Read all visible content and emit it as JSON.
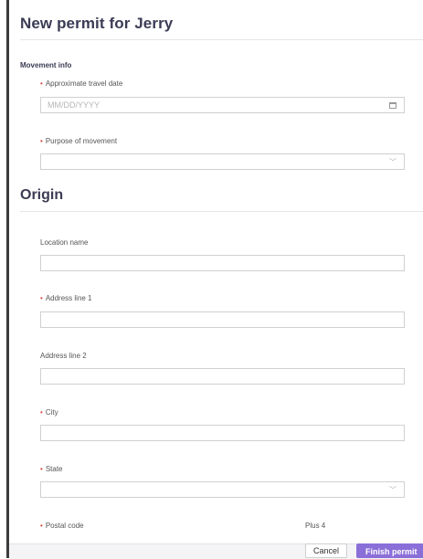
{
  "header": {
    "title": "New permit for Jerry"
  },
  "movement_info": {
    "section_label": "Movement info",
    "travel_date": {
      "label": "Approximate travel date",
      "placeholder": "MM/DD/YYYY",
      "value": ""
    },
    "purpose": {
      "label": "Purpose of movement",
      "value": ""
    }
  },
  "origin": {
    "title": "Origin",
    "location_name": {
      "label": "Location name",
      "value": ""
    },
    "address1": {
      "label": "Address line 1",
      "value": ""
    },
    "address2": {
      "label": "Address line 2",
      "value": ""
    },
    "city": {
      "label": "City",
      "value": ""
    },
    "state": {
      "label": "State",
      "value": ""
    },
    "postal_code": {
      "label": "Postal code"
    },
    "plus4": {
      "label": "Plus 4"
    }
  },
  "footer": {
    "cancel_label": "Cancel",
    "finish_label": "Finish permit"
  },
  "colors": {
    "accent": "#8b6fd8",
    "required": "#e04040",
    "heading": "#3b3b55"
  },
  "icons": {
    "calendar": "calendar-icon",
    "chevron": "chevron-down-icon"
  }
}
